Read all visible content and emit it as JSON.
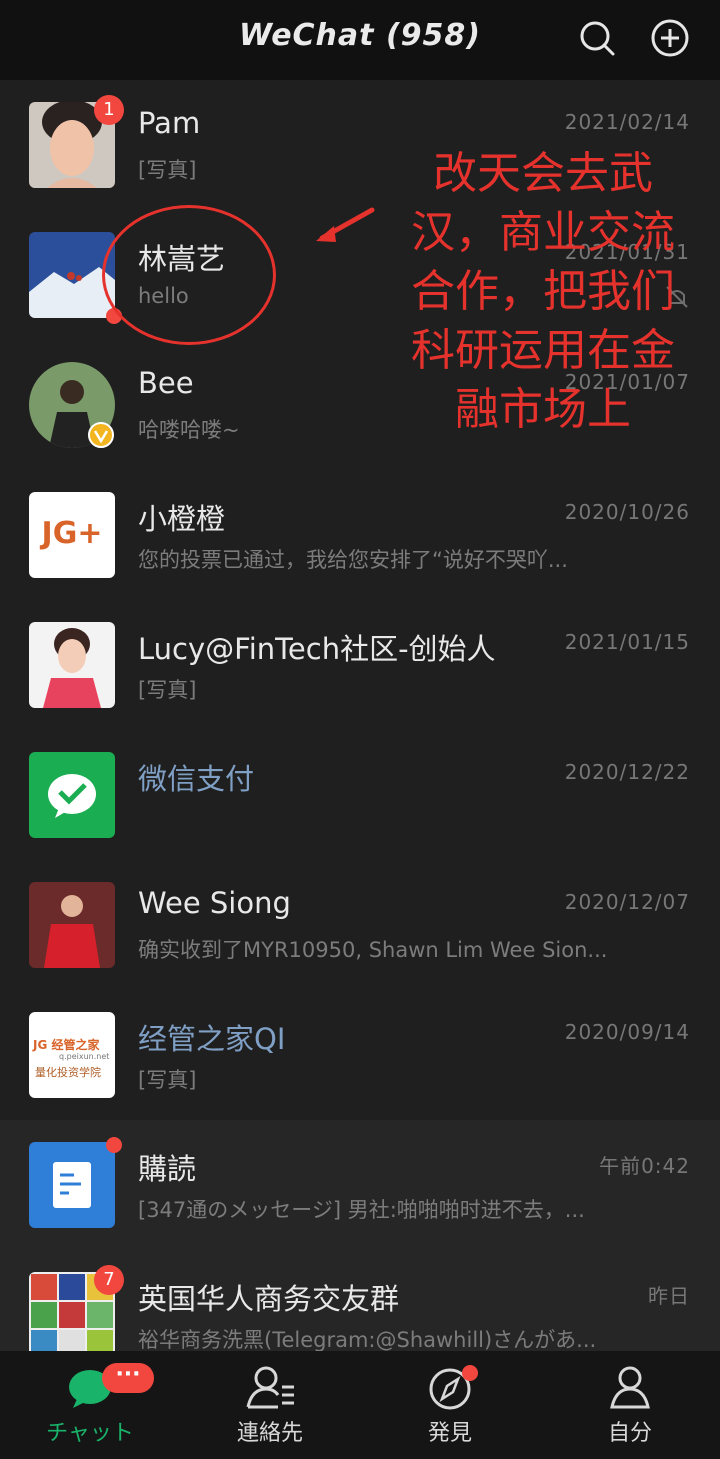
{
  "header": {
    "title": "WeChat (958)",
    "search_icon": "search-icon",
    "add_icon": "plus-circle-icon"
  },
  "chats": [
    {
      "name": "Pam",
      "preview": "[写真]",
      "time": "2021/02/14",
      "badge": "1"
    },
    {
      "name": "林嵩艺",
      "preview": "hello",
      "time": "2021/01/31",
      "muted": true
    },
    {
      "name": "Bee",
      "preview": "哈喽哈喽~",
      "time": "2021/01/07"
    },
    {
      "name": "小橙橙",
      "preview": "您的投票已通过，我给您安排了“说好不哭吖...",
      "time": "2020/10/26",
      "avatar_text": "JG+"
    },
    {
      "name": "Lucy@FinTech社区-创始人",
      "preview": "[写真]",
      "time": "2021/01/15"
    },
    {
      "name": "微信支付",
      "preview": "",
      "time": "2020/12/22"
    },
    {
      "name": "Wee Siong",
      "preview": "确实收到了MYR10950, Shawn Lim Wee Sion...",
      "time": "2020/12/07"
    },
    {
      "name": "经管之家QI",
      "preview": "[写真]",
      "time": "2020/09/14",
      "avatar_lines": [
        "JG 经管之家",
        "q.peixun.net",
        "量化投资学院"
      ]
    },
    {
      "name": "購読",
      "preview": "[347通のメッセージ] 男社:啪啪啪时进不去，...",
      "time": "午前0:42"
    },
    {
      "name": "英国华人商务交友群",
      "preview": "裕华商务洗黑(Telegram:@Shawhill)さんがあ...",
      "time": "昨日",
      "badge": "7"
    }
  ],
  "annotation": {
    "lines": [
      "改天会去武",
      "汉，商业交流",
      "合作，把我们",
      "科研运用在金",
      "融市场上"
    ]
  },
  "tabs": [
    {
      "label": "チャット",
      "icon": "chat-icon",
      "badge": "···"
    },
    {
      "label": "連絡先",
      "icon": "contacts-icon"
    },
    {
      "label": "発見",
      "icon": "compass-icon"
    },
    {
      "label": "自分",
      "icon": "profile-icon"
    }
  ],
  "colors": {
    "accent": "#19b46a",
    "badge": "#f2473f",
    "annotation": "#e6322d",
    "link_name": "#7f9fc5"
  }
}
